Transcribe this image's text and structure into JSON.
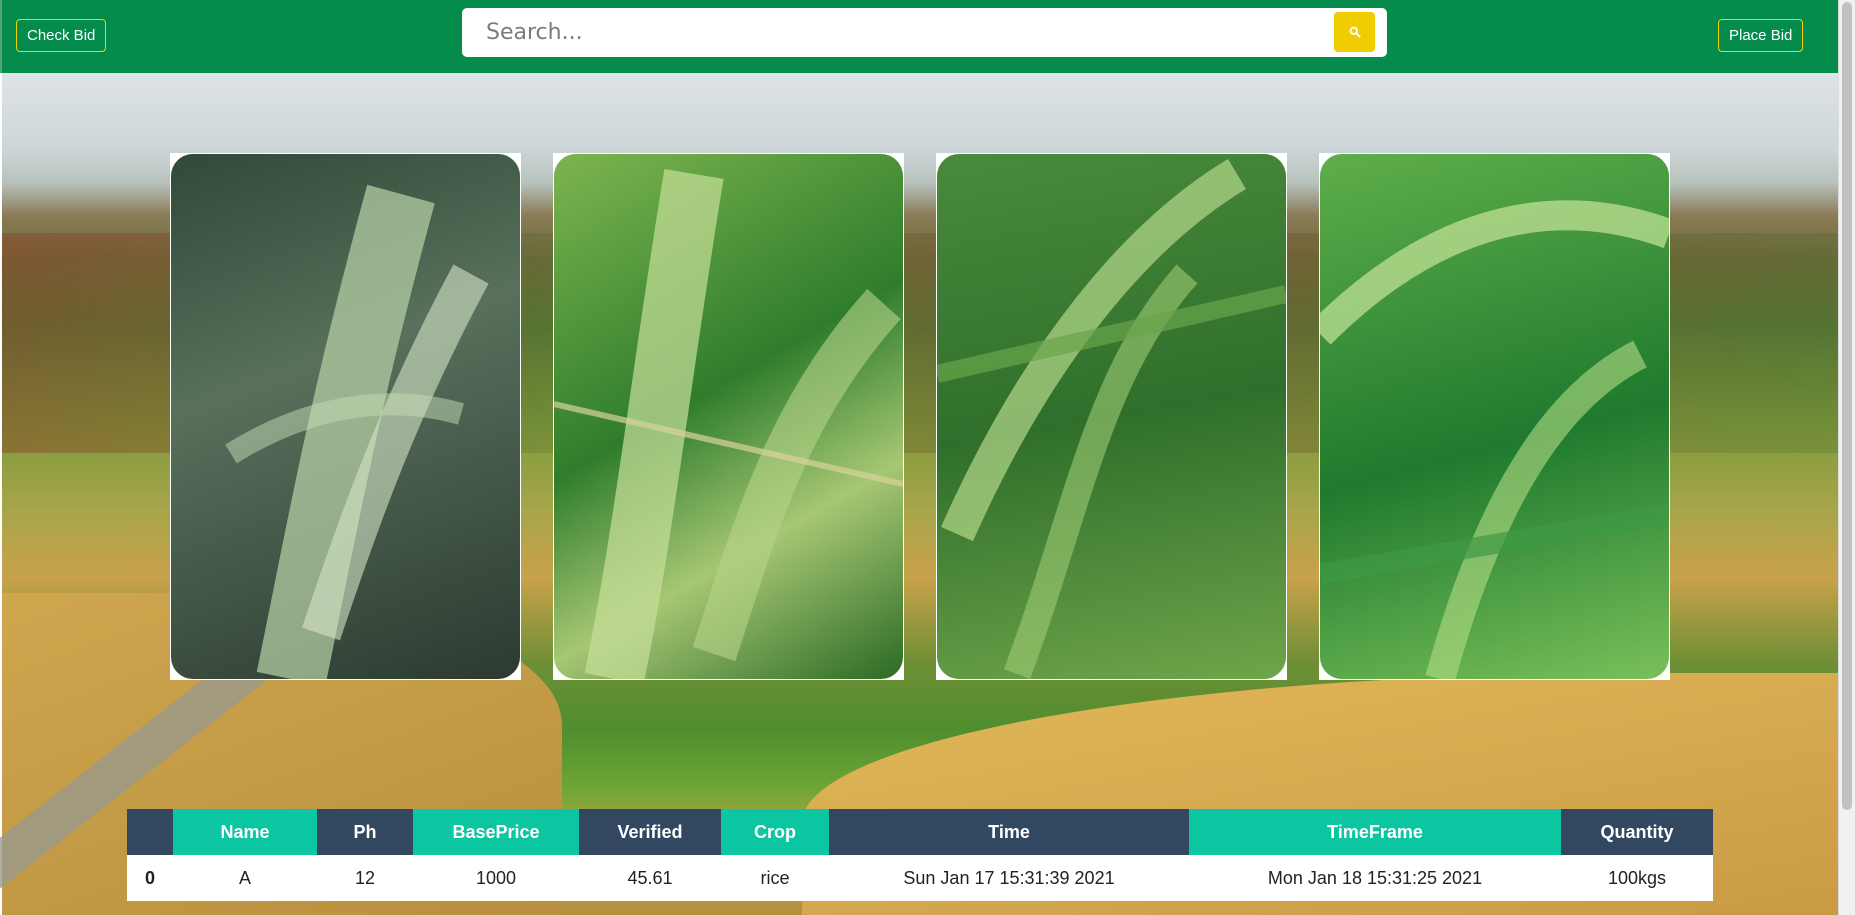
{
  "nav": {
    "check_bid_label": "Check Bid",
    "place_bid_label": "Place Bid",
    "search_placeholder": "Search...",
    "search_icon": "search-icon"
  },
  "colors": {
    "navbar": "#058b4c",
    "accent_yellow": "#f0cd00",
    "table_dark": "#324860",
    "table_teal": "#0bc6a0"
  },
  "gallery": {
    "cards": [
      {
        "image": "rice-flower-photo"
      },
      {
        "image": "rice-grain-photo"
      },
      {
        "image": "rice-plant-photo"
      },
      {
        "image": "rice-panicle-photo"
      }
    ]
  },
  "table": {
    "headers": [
      "",
      "Name",
      "Ph",
      "BasePrice",
      "Verified",
      "Crop",
      "Time",
      "TimeFrame",
      "Quantity"
    ],
    "rows": [
      [
        "0",
        "A",
        "12",
        "1000",
        "45.61",
        "rice",
        "Sun Jan 17 15:31:39 2021",
        "Mon Jan 18 15:31:25 2021",
        "100kgs"
      ]
    ]
  }
}
